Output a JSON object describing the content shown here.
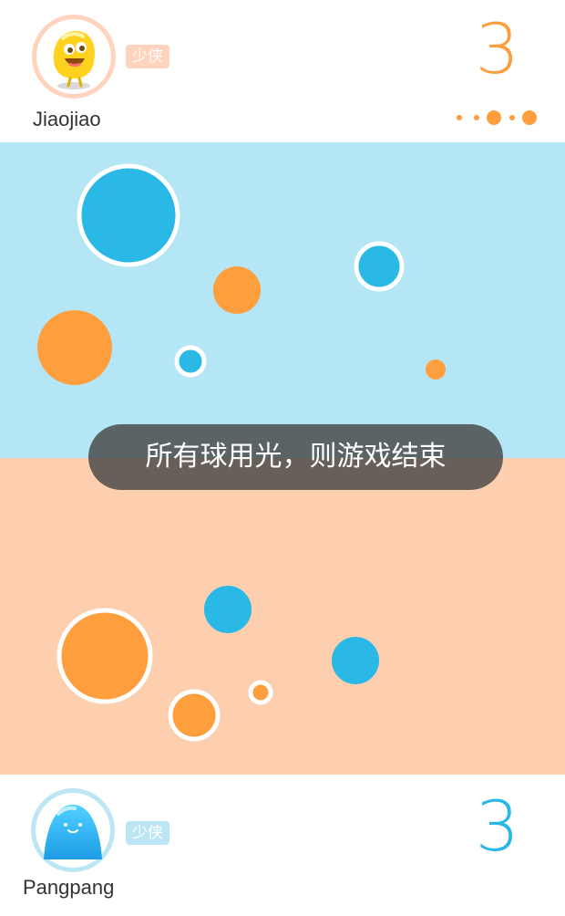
{
  "players": {
    "top": {
      "name": "Jiaojiao",
      "rank_badge": "少侠",
      "score": "3",
      "avatar_icon": "yellow-blob-character-icon",
      "color": "#ff9e3d",
      "progress_dots": [
        {
          "size": "small"
        },
        {
          "size": "small"
        },
        {
          "size": "large"
        },
        {
          "size": "small"
        },
        {
          "size": "large"
        }
      ]
    },
    "bottom": {
      "name": "Pangpang",
      "rank_badge": "少侠",
      "score": "3",
      "avatar_icon": "blue-blob-character-icon",
      "color": "#2ab8e6"
    }
  },
  "field": {
    "top_color": "#b5e6f5",
    "bottom_color": "#fdcfae",
    "balls": [
      {
        "zone": "top",
        "color": "blue",
        "size": "large",
        "outlined": true
      },
      {
        "zone": "top",
        "color": "orange",
        "size": "medium",
        "outlined": false
      },
      {
        "zone": "top",
        "color": "blue",
        "size": "medium",
        "outlined": true
      },
      {
        "zone": "top",
        "color": "orange",
        "size": "large",
        "outlined": false
      },
      {
        "zone": "top",
        "color": "blue",
        "size": "small",
        "outlined": true
      },
      {
        "zone": "top",
        "color": "orange",
        "size": "tiny",
        "outlined": false
      },
      {
        "zone": "bottom",
        "color": "blue",
        "size": "medium",
        "outlined": false
      },
      {
        "zone": "bottom",
        "color": "orange",
        "size": "large",
        "outlined": true
      },
      {
        "zone": "bottom",
        "color": "blue",
        "size": "medium",
        "outlined": false
      },
      {
        "zone": "bottom",
        "color": "orange",
        "size": "small",
        "outlined": true
      },
      {
        "zone": "bottom",
        "color": "orange",
        "size": "medium",
        "outlined": true
      }
    ]
  },
  "toast": {
    "message": "所有球用光，则游戏结束"
  },
  "colors": {
    "orange": "#ff9e3d",
    "blue": "#2ab8e6",
    "orange_light": "#ffd3bd",
    "blue_light": "#bde6f5"
  }
}
